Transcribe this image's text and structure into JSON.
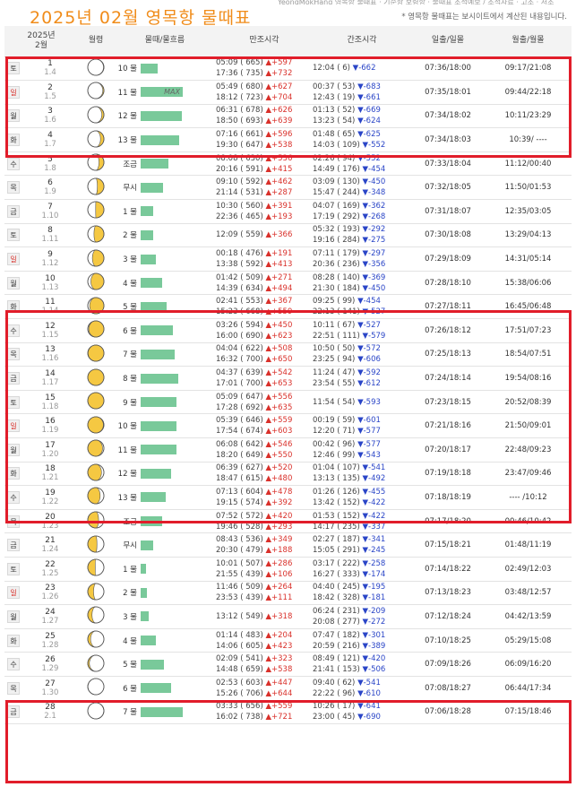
{
  "header": {
    "top_strip": "YeongMokHang 영목항 물때표 · 기준항 보령항 · 물때표 조석예보 / 조석자료 · 고조 · 저조",
    "title": "2025년  02월  영목항  물때표",
    "notice": "* 영목항 물때표는 보시이트에서 계산된 내용입니다."
  },
  "columns": {
    "date_year": "2025년",
    "date_month": "2월",
    "moon": "월령",
    "mulddae": "물때/물흐름",
    "high": "만조시각",
    "low": "간조시각",
    "sun": "일출/일몰",
    "moonrise": "월출/월몰"
  },
  "rows": [
    {
      "dow": "토",
      "red": false,
      "day": "1",
      "lunar": "1.4",
      "phase": 1.5,
      "mul": "10 물",
      "flow": 0.3,
      "max": "",
      "h1": "05:09 ( 665)",
      "h1c": "▲+597",
      "h2": "17:36 ( 735)",
      "h2c": "▲+732",
      "l1": "12:04 (   6)",
      "l1c": "▼-662",
      "l2": "",
      "l2c": "",
      "sun": "07:36/18:00",
      "mr": "09:17/21:08"
    },
    {
      "dow": "일",
      "red": true,
      "day": "2",
      "lunar": "1.5",
      "phase": 2.5,
      "mul": "11 물",
      "flow": 0.75,
      "max": "MAX",
      "h1": "05:49 ( 680)",
      "h1c": "▲+627",
      "h2": "18:12 ( 723)",
      "h2c": "▲+704",
      "l1": "00:37 (  53)",
      "l1c": "▼-683",
      "l2": "12:43 (  19)",
      "l2c": "▼-661",
      "sun": "07:35/18:01",
      "mr": "09:44/22:18"
    },
    {
      "dow": "월",
      "red": false,
      "day": "3",
      "lunar": "1.6",
      "phase": 3.5,
      "mul": "12 물",
      "flow": 0.74,
      "max": "",
      "h1": "06:31 ( 678)",
      "h1c": "▲+626",
      "h2": "18:50 ( 693)",
      "h2c": "▲+639",
      "l1": "01:13 (  52)",
      "l1c": "▼-669",
      "l2": "13:23 (  54)",
      "l2c": "▼-624",
      "sun": "07:34/18:02",
      "mr": "10:11/23:29"
    },
    {
      "dow": "화",
      "red": false,
      "day": "4",
      "lunar": "1.7",
      "phase": 4.5,
      "mul": "13 물",
      "flow": 0.7,
      "max": "",
      "h1": "07:16 ( 661)",
      "h1c": "▲+596",
      "h2": "19:30 ( 647)",
      "h2c": "▲+538",
      "l1": "01:48 (  65)",
      "l1c": "▼-625",
      "l2": "14:03 ( 109)",
      "l2c": "▼-552",
      "sun": "07:34/18:03",
      "mr": "10:39/ ----"
    },
    {
      "dow": "수",
      "red": false,
      "day": "5",
      "lunar": "1.8",
      "phase": 5.5,
      "mul": "조금",
      "flow": 0.5,
      "max": "",
      "h1": "08:08 ( 630)",
      "h1c": "▲+536",
      "h2": "20:16 ( 591)",
      "h2c": "▲+415",
      "l1": "02:26 (  94)",
      "l1c": "▼-552",
      "l2": "14:49 ( 176)",
      "l2c": "▼-454",
      "sun": "07:33/18:04",
      "mr": "11:12/00:40"
    },
    {
      "dow": "목",
      "red": false,
      "day": "6",
      "lunar": "1.9",
      "phase": 6.5,
      "mul": "무시",
      "flow": 0.4,
      "max": "",
      "h1": "09:10 ( 592)",
      "h1c": "▲+462",
      "h2": "21:14 ( 531)",
      "h2c": "▲+287",
      "l1": "03:09 ( 130)",
      "l1c": "▼-450",
      "l2": "15:47 ( 244)",
      "l2c": "▼-348",
      "sun": "07:32/18:05",
      "mr": "11:50/01:53"
    },
    {
      "dow": "금",
      "red": false,
      "day": "7",
      "lunar": "1.10",
      "phase": 7.5,
      "mul": "1 물",
      "flow": 0.22,
      "max": "",
      "h1": "10:30 ( 560)",
      "h1c": "▲+391",
      "h2": "22:36 ( 465)",
      "h2c": "▲+193",
      "l1": "04:07 ( 169)",
      "l1c": "▼-362",
      "l2": "17:19 ( 292)",
      "l2c": "▼-268",
      "sun": "07:31/18:07",
      "mr": "12:35/03:05"
    },
    {
      "dow": "토",
      "red": false,
      "day": "8",
      "lunar": "1.11",
      "phase": 8.5,
      "mul": "2 물",
      "flow": 0.22,
      "max": "",
      "h1": "12:09 ( 559)",
      "h1c": "▲+366",
      "h2": "",
      "h2c": "",
      "l1": "05:32 ( 193)",
      "l1c": "▼-292",
      "l2": "19:16 ( 284)",
      "l2c": "▼-275",
      "sun": "07:30/18:08",
      "mr": "13:29/04:13"
    },
    {
      "dow": "일",
      "red": true,
      "day": "9",
      "lunar": "1.12",
      "phase": 9.5,
      "mul": "3 물",
      "flow": 0.28,
      "max": "",
      "h1": "00:18 ( 476)",
      "h1c": "▲+191",
      "h2": "13:38 ( 592)",
      "h2c": "▲+413",
      "l1": "07:11 ( 179)",
      "l1c": "▼-297",
      "l2": "20:36 ( 236)",
      "l2c": "▼-356",
      "sun": "07:29/18:09",
      "mr": "14:31/05:14"
    },
    {
      "dow": "월",
      "red": false,
      "day": "10",
      "lunar": "1.13",
      "phase": 10.5,
      "mul": "4 물",
      "flow": 0.38,
      "max": "",
      "h1": "01:42 ( 509)",
      "h1c": "▲+271",
      "h2": "14:39 ( 634)",
      "h2c": "▲+494",
      "l1": "08:28 ( 140)",
      "l1c": "▼-369",
      "l2": "21:30 ( 184)",
      "l2c": "▼-450",
      "sun": "07:28/18:10",
      "mr": "15:38/06:06"
    },
    {
      "dow": "화",
      "red": false,
      "day": "11",
      "lunar": "1.14",
      "phase": 11.5,
      "mul": "5 물",
      "flow": 0.47,
      "max": "",
      "h1": "02:41 ( 553)",
      "h1c": "▲+367",
      "h2": "15:23 ( 668)",
      "h2c": "▲+559",
      "l1": "09:25 (  99)",
      "l1c": "▼-454",
      "l2": "22:13 ( 141)",
      "l2c": "▼-527",
      "sun": "07:27/18:11",
      "mr": "16:45/06:48"
    },
    {
      "dow": "수",
      "red": false,
      "day": "12",
      "lunar": "1.15",
      "phase": 12.5,
      "mul": "6 물",
      "flow": 0.58,
      "max": "",
      "h1": "03:26 ( 594)",
      "h1c": "▲+450",
      "h2": "16:00 ( 690)",
      "h2c": "▲+623",
      "l1": "10:11 (  67)",
      "l1c": "▼-527",
      "l2": "22:51 ( 111)",
      "l2c": "▼-579",
      "sun": "07:26/18:12",
      "mr": "17:51/07:23"
    },
    {
      "dow": "목",
      "red": false,
      "day": "13",
      "lunar": "1.16",
      "phase": 13.5,
      "mul": "7 물",
      "flow": 0.62,
      "max": "",
      "h1": "04:04 ( 622)",
      "h1c": "▲+508",
      "h2": "16:32 ( 700)",
      "h2c": "▲+650",
      "l1": "10:50 (  50)",
      "l1c": "▼-572",
      "l2": "23:25 (  94)",
      "l2c": "▼-606",
      "sun": "07:25/18:13",
      "mr": "18:54/07:51"
    },
    {
      "dow": "금",
      "red": false,
      "day": "14",
      "lunar": "1.17",
      "phase": 14.5,
      "mul": "8 물",
      "flow": 0.68,
      "max": "",
      "h1": "04:37 ( 639)",
      "h1c": "▲+542",
      "h2": "17:01 ( 700)",
      "h2c": "▲+653",
      "l1": "11:24 (  47)",
      "l1c": "▼-592",
      "l2": "23:54 (  55)",
      "l2c": "▼-612",
      "sun": "07:24/18:14",
      "mr": "19:54/08:16"
    },
    {
      "dow": "토",
      "red": false,
      "day": "15",
      "lunar": "1.18",
      "phase": 15.5,
      "mul": "9 물",
      "flow": 0.64,
      "max": "",
      "h1": "05:09 ( 647)",
      "h1c": "▲+556",
      "h2": "17:28 ( 692)",
      "h2c": "▲+635",
      "l1": "11:54 (  54)",
      "l1c": "▼-593",
      "l2": "",
      "l2c": "",
      "sun": "07:23/18:15",
      "mr": "20:52/08:39"
    },
    {
      "dow": "일",
      "red": true,
      "day": "16",
      "lunar": "1.19",
      "phase": 16.5,
      "mul": "10 물",
      "flow": 0.64,
      "max": "",
      "h1": "05:39 ( 646)",
      "h1c": "▲+559",
      "h2": "17:54 ( 674)",
      "h2c": "▲+603",
      "l1": "00:19 (  59)",
      "l1c": "▼-601",
      "l2": "12:20 (  71)",
      "l2c": "▼-577",
      "sun": "07:21/18:16",
      "mr": "21:50/09:01"
    },
    {
      "dow": "월",
      "red": false,
      "day": "17",
      "lunar": "1.20",
      "phase": 17.5,
      "mul": "11 물",
      "flow": 0.64,
      "max": "",
      "h1": "06:08 ( 642)",
      "h1c": "▲+546",
      "h2": "18:20 ( 649)",
      "h2c": "▲+550",
      "l1": "00:42 (  96)",
      "l1c": "▼-577",
      "l2": "12:46 (  99)",
      "l2c": "▼-543",
      "sun": "07:20/18:17",
      "mr": "22:48/09:23"
    },
    {
      "dow": "화",
      "red": false,
      "day": "18",
      "lunar": "1.21",
      "phase": 18.5,
      "mul": "12 물",
      "flow": 0.55,
      "max": "",
      "h1": "06:39 ( 627)",
      "h1c": "▲+520",
      "h2": "18:47 ( 615)",
      "h2c": "▲+480",
      "l1": "01:04 ( 107)",
      "l1c": "▼-541",
      "l2": "13:13 ( 135)",
      "l2c": "▼-492",
      "sun": "07:19/18:18",
      "mr": "23:47/09:46"
    },
    {
      "dow": "수",
      "red": false,
      "day": "19",
      "lunar": "1.22",
      "phase": 19.5,
      "mul": "13 물",
      "flow": 0.45,
      "max": "",
      "h1": "07:13 ( 604)",
      "h1c": "▲+478",
      "h2": "19:15 ( 574)",
      "h2c": "▲+392",
      "l1": "01:26 ( 126)",
      "l1c": "▼-455",
      "l2": "13:42 ( 152)",
      "l2c": "▼-422",
      "sun": "07:18/18:19",
      "mr": "---- /10:12"
    },
    {
      "dow": "목",
      "red": false,
      "day": "20",
      "lunar": "1.23",
      "phase": 20.5,
      "mul": "조금",
      "flow": 0.38,
      "max": "",
      "h1": "07:52 ( 572)",
      "h1c": "▲+420",
      "h2": "19:46 ( 528)",
      "h2c": "▲+293",
      "l1": "01:53 ( 152)",
      "l1c": "▼-422",
      "l2": "14:17 ( 235)",
      "l2c": "▼-337",
      "sun": "07:17/18:20",
      "mr": "00:46/10:42"
    },
    {
      "dow": "금",
      "red": false,
      "day": "21",
      "lunar": "1.24",
      "phase": 21.5,
      "mul": "무시",
      "flow": 0.22,
      "max": "",
      "h1": "08:43 ( 536)",
      "h1c": "▲+349",
      "h2": "20:30 ( 479)",
      "h2c": "▲+188",
      "l1": "02:27 ( 187)",
      "l1c": "▼-341",
      "l2": "15:05 ( 291)",
      "l2c": "▼-245",
      "sun": "07:15/18:21",
      "mr": "01:48/11:19"
    },
    {
      "dow": "토",
      "red": false,
      "day": "22",
      "lunar": "1.25",
      "phase": 22.5,
      "mul": "1 물",
      "flow": 0.1,
      "max": "",
      "h1": "10:01 ( 507)",
      "h1c": "▲+286",
      "h2": "21:55 ( 439)",
      "h2c": "▲+106",
      "l1": "03:17 ( 222)",
      "l1c": "▼-258",
      "l2": "16:27 ( 333)",
      "l2c": "▼-174",
      "sun": "07:14/18:22",
      "mr": "02:49/12:03"
    },
    {
      "dow": "일",
      "red": true,
      "day": "23",
      "lunar": "1.26",
      "phase": 23.5,
      "mul": "2 물",
      "flow": 0.12,
      "max": "",
      "h1": "11:46 ( 509)",
      "h1c": "▲+264",
      "h2": "23:53 ( 439)",
      "h2c": "▲+111",
      "l1": "04:40 ( 245)",
      "l1c": "▼-195",
      "l2": "18:42 ( 328)",
      "l2c": "▼-181",
      "sun": "07:13/18:23",
      "mr": "03:48/12:57"
    },
    {
      "dow": "월",
      "red": false,
      "day": "24",
      "lunar": "1.27",
      "phase": 24.5,
      "mul": "3 물",
      "flow": 0.14,
      "max": "",
      "h1": "13:12 ( 549)",
      "h1c": "▲+318",
      "h2": "",
      "h2c": "",
      "l1": "06:24 ( 231)",
      "l1c": "▼-209",
      "l2": "20:08 ( 277)",
      "l2c": "▼-272",
      "sun": "07:12/18:24",
      "mr": "04:42/13:59"
    },
    {
      "dow": "화",
      "red": false,
      "day": "25",
      "lunar": "1.28",
      "phase": 25.5,
      "mul": "4 물",
      "flow": 0.28,
      "max": "",
      "h1": "01:14 ( 483)",
      "h1c": "▲+204",
      "h2": "14:06 ( 605)",
      "h2c": "▲+423",
      "l1": "07:47 ( 182)",
      "l1c": "▼-301",
      "l2": "20:59 ( 216)",
      "l2c": "▼-389",
      "sun": "07:10/18:25",
      "mr": "05:29/15:08"
    },
    {
      "dow": "수",
      "red": false,
      "day": "26",
      "lunar": "1.29",
      "phase": 26.5,
      "mul": "5 물",
      "flow": 0.42,
      "max": "",
      "h1": "02:09 ( 541)",
      "h1c": "▲+323",
      "h2": "14:48 ( 659)",
      "h2c": "▲+538",
      "l1": "08:49 ( 121)",
      "l1c": "▼-420",
      "l2": "21:41 ( 153)",
      "l2c": "▼-506",
      "sun": "07:09/18:26",
      "mr": "06:09/16:20"
    },
    {
      "dow": "목",
      "red": false,
      "day": "27",
      "lunar": "1.30",
      "phase": 28.5,
      "mul": "6 물",
      "flow": 0.55,
      "max": "",
      "h1": "02:53 ( 603)",
      "h1c": "▲+447",
      "h2": "15:26 ( 706)",
      "h2c": "▲+644",
      "l1": "09:40 (  62)",
      "l1c": "▼-541",
      "l2": "22:22 (  96)",
      "l2c": "▼-610",
      "sun": "07:08/18:27",
      "mr": "06:44/17:34"
    },
    {
      "dow": "금",
      "red": false,
      "day": "28",
      "lunar": "2.1",
      "phase": 1.0,
      "mul": "7 물",
      "flow": 0.75,
      "max": "",
      "h1": "03:33 ( 656)",
      "h1c": "▲+559",
      "h2": "16:02 ( 738)",
      "h2c": "▲+721",
      "l1": "10:26 (  17)",
      "l1c": "▼-641",
      "l2": "23:00 (  45)",
      "l2c": "▼-690",
      "sun": "07:06/18:28",
      "mr": "07:15/18:46"
    }
  ]
}
